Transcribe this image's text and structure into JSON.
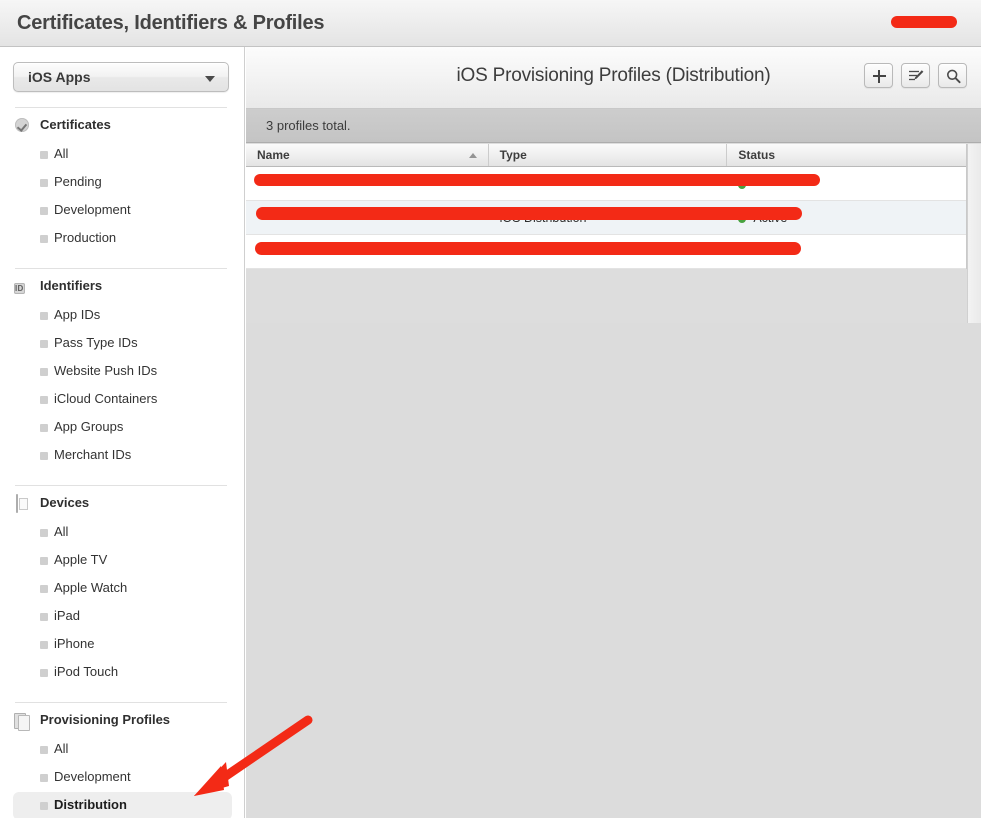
{
  "window": {
    "title": "Certificates, Identifiers & Profiles",
    "redaction_present": true
  },
  "sidebar": {
    "team_select": {
      "value": "iOS Apps",
      "arrow_icon": "chevron-down-icon"
    },
    "groups": [
      {
        "title": "Certificates",
        "icon": "certificate-seal-icon",
        "items": [
          {
            "label": "All",
            "selected": false
          },
          {
            "label": "Pending",
            "selected": false
          },
          {
            "label": "Development",
            "selected": false
          },
          {
            "label": "Production",
            "selected": false
          }
        ]
      },
      {
        "title": "Identifiers",
        "icon": "id-badge-icon",
        "items": [
          {
            "label": "App IDs",
            "selected": false
          },
          {
            "label": "Pass Type IDs",
            "selected": false
          },
          {
            "label": "Website Push IDs",
            "selected": false
          },
          {
            "label": "iCloud Containers",
            "selected": false
          },
          {
            "label": "App Groups",
            "selected": false
          },
          {
            "label": "Merchant IDs",
            "selected": false
          }
        ]
      },
      {
        "title": "Devices",
        "icon": "device-phone-icon",
        "items": [
          {
            "label": "All",
            "selected": false
          },
          {
            "label": "Apple TV",
            "selected": false
          },
          {
            "label": "Apple Watch",
            "selected": false
          },
          {
            "label": "iPad",
            "selected": false
          },
          {
            "label": "iPhone",
            "selected": false
          },
          {
            "label": "iPod Touch",
            "selected": false
          }
        ]
      },
      {
        "title": "Provisioning Profiles",
        "icon": "document-pages-icon",
        "items": [
          {
            "label": "All",
            "selected": false
          },
          {
            "label": "Development",
            "selected": false
          },
          {
            "label": "Distribution",
            "selected": true
          }
        ]
      }
    ]
  },
  "main": {
    "title": "iOS Provisioning Profiles (Distribution)",
    "toolbar": [
      {
        "name": "add-profile-button",
        "icon": "plus-icon"
      },
      {
        "name": "edit-profiles-button",
        "icon": "edit-list-icon"
      },
      {
        "name": "search-button",
        "icon": "search-icon"
      }
    ],
    "count_text": "3 profiles total.",
    "table": {
      "columns": [
        {
          "label": "Name",
          "sorted": "asc"
        },
        {
          "label": "Type",
          "sorted": "none"
        },
        {
          "label": "Status",
          "sorted": "none"
        }
      ],
      "rows": [
        {
          "name": "",
          "type": "",
          "status": "",
          "redacted": true,
          "status_dot": true
        },
        {
          "name": "",
          "type": "iOS Distribution",
          "status": "Active",
          "redacted": true,
          "status_dot": true
        },
        {
          "name": "",
          "type": "",
          "status": "",
          "redacted": true,
          "status_dot": false
        }
      ]
    }
  },
  "annotation": {
    "arrow_color": "#f32a16",
    "points_to": "sidebar-item-distribution"
  }
}
